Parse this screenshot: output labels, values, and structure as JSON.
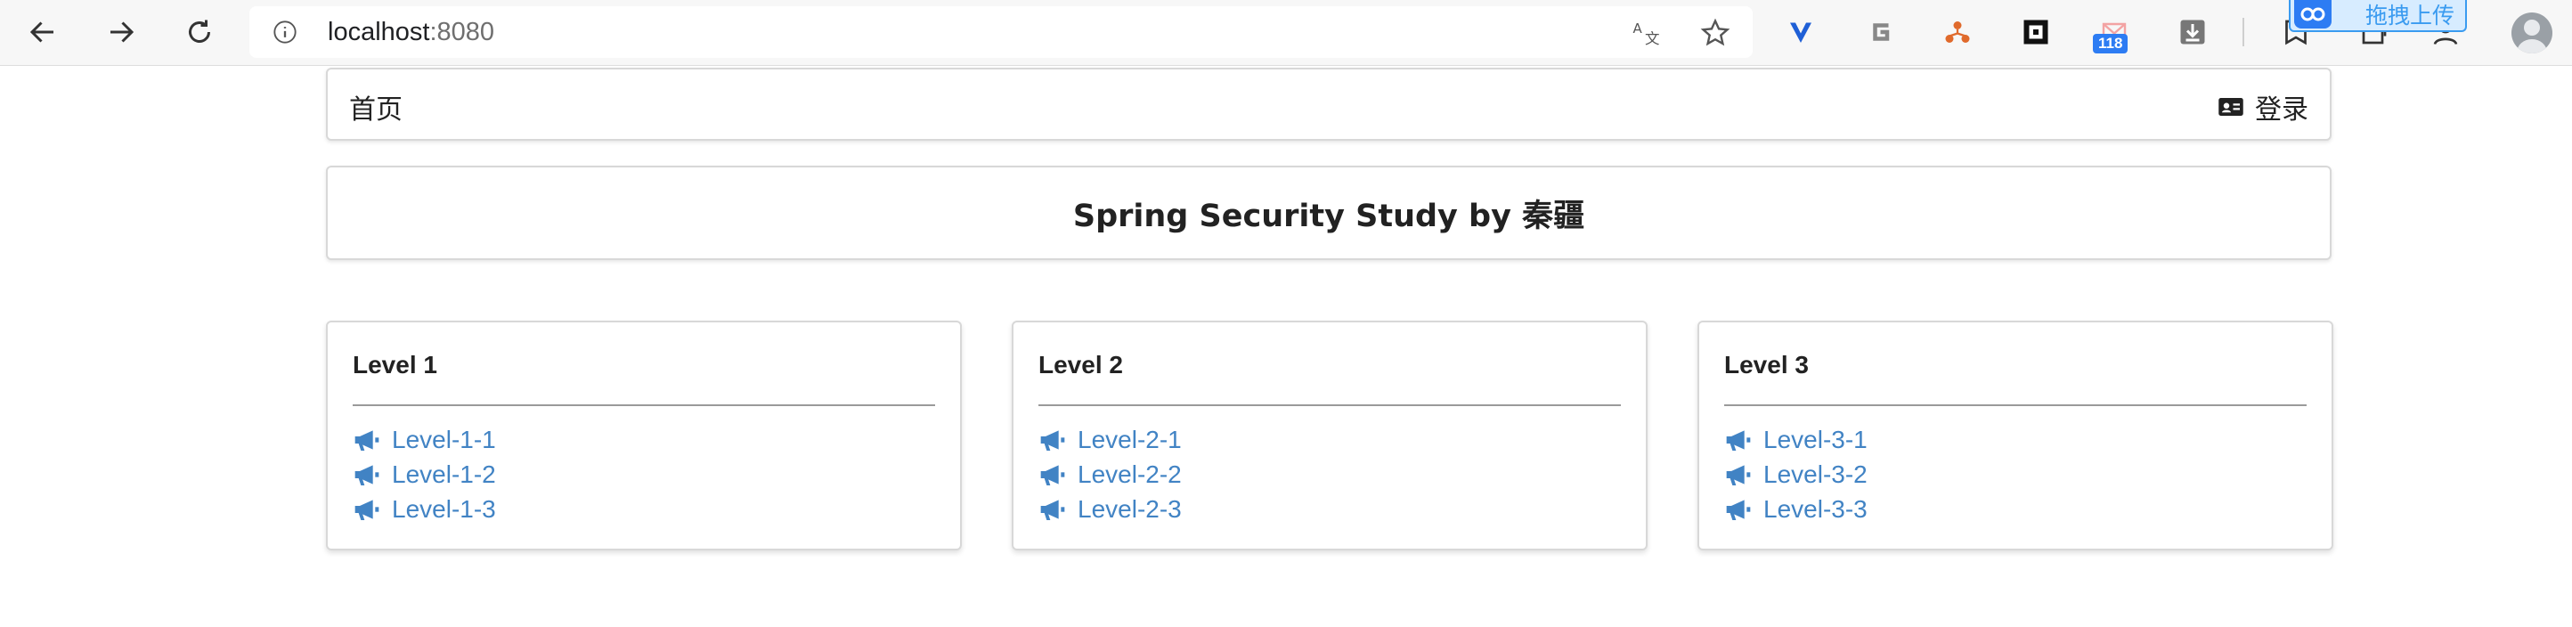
{
  "browser": {
    "url_host": "localhost",
    "url_port": ":8080",
    "tab_count_badge": "118",
    "upload_widget_label": "拖拽上传",
    "icons": [
      "back-icon",
      "forward-icon",
      "reload-icon",
      "info-icon",
      "translate-icon",
      "star-icon"
    ]
  },
  "menu": {
    "home_label": "首页",
    "login_label": "登录"
  },
  "header": {
    "title": "Spring Security Study by 秦疆"
  },
  "levels": [
    {
      "title": "Level 1",
      "links": [
        "Level-1-1",
        "Level-1-2",
        "Level-1-3"
      ]
    },
    {
      "title": "Level 2",
      "links": [
        "Level-2-1",
        "Level-2-2",
        "Level-2-3"
      ]
    },
    {
      "title": "Level 3",
      "links": [
        "Level-3-1",
        "Level-3-2",
        "Level-3-3"
      ]
    }
  ],
  "colors": {
    "link": "#4183c4",
    "border": "#d8d8d8",
    "text": "#222222"
  }
}
